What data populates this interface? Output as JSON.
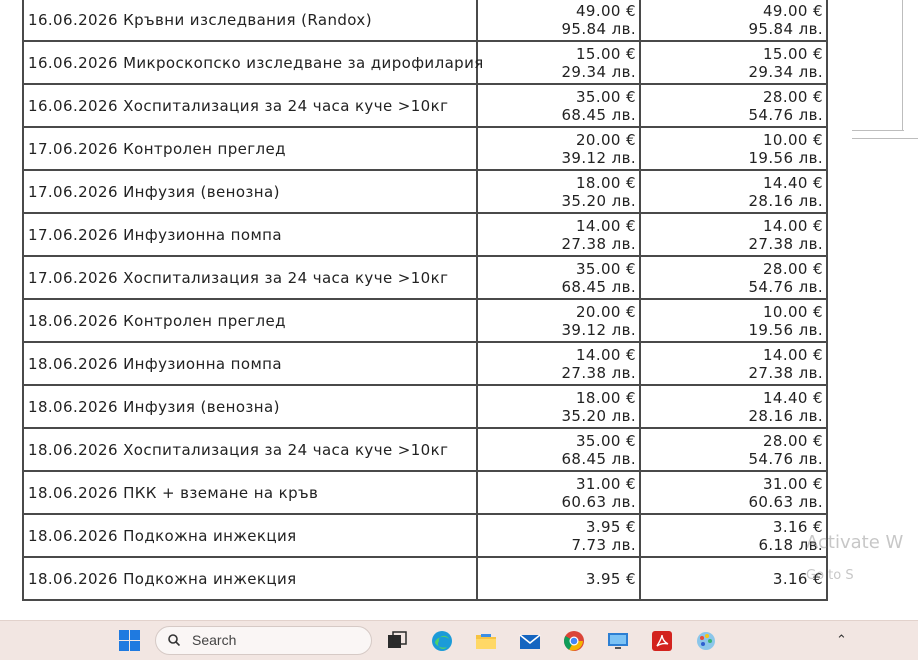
{
  "rows": [
    {
      "date": "16.06.2026",
      "desc": "Кръвни изследвания (Randox)",
      "price_eur": "49.00 €",
      "price_lv": "95.84 лв.",
      "total_eur": "49.00 €",
      "total_lv": "95.84 лв."
    },
    {
      "date": "16.06.2026",
      "desc": "Микроскопско изследване за дирофилария",
      "price_eur": "15.00 €",
      "price_lv": "29.34 лв.",
      "total_eur": "15.00 €",
      "total_lv": "29.34 лв."
    },
    {
      "date": "16.06.2026",
      "desc": "Хоспитализация за 24 часа куче >10кг",
      "price_eur": "35.00 €",
      "price_lv": "68.45 лв.",
      "total_eur": "28.00 €",
      "total_lv": "54.76 лв."
    },
    {
      "date": "17.06.2026",
      "desc": "Контролен преглед",
      "price_eur": "20.00 €",
      "price_lv": "39.12 лв.",
      "total_eur": "10.00 €",
      "total_lv": "19.56 лв."
    },
    {
      "date": "17.06.2026",
      "desc": "Инфузия (венозна)",
      "price_eur": "18.00 €",
      "price_lv": "35.20 лв.",
      "total_eur": "14.40 €",
      "total_lv": "28.16 лв."
    },
    {
      "date": "17.06.2026",
      "desc": "Инфузионна помпа",
      "price_eur": "14.00 €",
      "price_lv": "27.38 лв.",
      "total_eur": "14.00 €",
      "total_lv": "27.38 лв."
    },
    {
      "date": "17.06.2026",
      "desc": "Хоспитализация за 24 часа куче >10кг",
      "price_eur": "35.00 €",
      "price_lv": "68.45 лв.",
      "total_eur": "28.00 €",
      "total_lv": "54.76 лв."
    },
    {
      "date": "18.06.2026",
      "desc": "Контролен преглед",
      "price_eur": "20.00 €",
      "price_lv": "39.12 лв.",
      "total_eur": "10.00 €",
      "total_lv": "19.56 лв."
    },
    {
      "date": "18.06.2026",
      "desc": "Инфузионна помпа",
      "price_eur": "14.00 €",
      "price_lv": "27.38 лв.",
      "total_eur": "14.00 €",
      "total_lv": "27.38 лв."
    },
    {
      "date": "18.06.2026",
      "desc": "Инфузия (венозна)",
      "price_eur": "18.00 €",
      "price_lv": "35.20 лв.",
      "total_eur": "14.40 €",
      "total_lv": "28.16 лв."
    },
    {
      "date": "18.06.2026",
      "desc": "Хоспитализация за 24 часа куче >10кг",
      "price_eur": "35.00 €",
      "price_lv": "68.45 лв.",
      "total_eur": "28.00 €",
      "total_lv": "54.76 лв."
    },
    {
      "date": "18.06.2026",
      "desc": "ПКК + вземане на кръв",
      "price_eur": "31.00 €",
      "price_lv": "60.63 лв.",
      "total_eur": "31.00 €",
      "total_lv": "60.63 лв."
    },
    {
      "date": "18.06.2026",
      "desc": "Подкожна инжекция",
      "price_eur": "3.95 €",
      "price_lv": "7.73 лв.",
      "total_eur": "3.16 €",
      "total_lv": "6.18 лв."
    },
    {
      "date": "18.06.2026",
      "desc": "Подкожна инжекция",
      "price_eur": "3.95 €",
      "price_lv": "",
      "total_eur": "3.16 €",
      "total_lv": ""
    }
  ],
  "watermark": {
    "line1": "Activate W",
    "line2": "Go to S"
  },
  "taskbar": {
    "search_placeholder": "Search",
    "icons": [
      "windows-start-icon",
      "search-icon",
      "task-view-icon",
      "edge-browser-icon",
      "file-explorer-icon",
      "mail-icon",
      "chrome-icon",
      "remote-desktop-icon",
      "pdf-reader-icon",
      "paint-icon",
      "chevron-up-icon"
    ]
  },
  "colors": {
    "taskbar_bg": "#f2e6e2",
    "grid": "#4a4a4a",
    "windows_blue": "#1f7ae0"
  }
}
